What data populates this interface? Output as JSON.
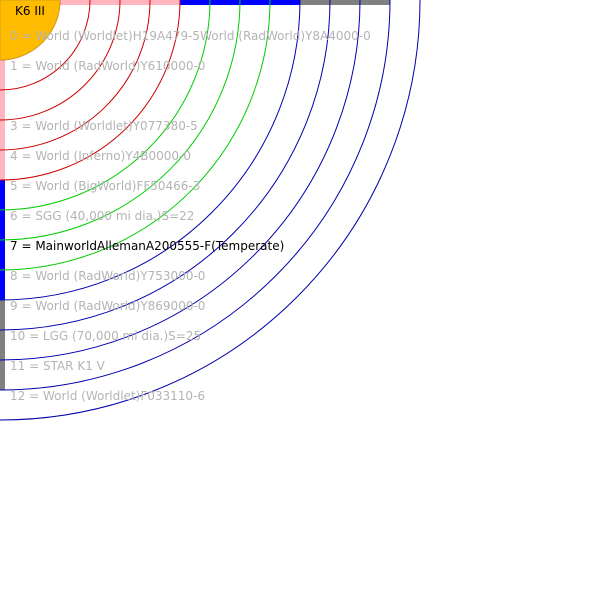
{
  "star": {
    "label": "K6 III",
    "fill_color": "#ffbb00",
    "edge_color": "#d4a017"
  },
  "zone_colors": {
    "hot": "#cc0000",
    "habitable": "#00cc00",
    "cold": "#0000aa",
    "pink": "#ffb6c1",
    "blue": "#0000ff",
    "gray": "#808080"
  },
  "orbit_zones": [
    "hot",
    "hot",
    "hot",
    "hot",
    "hot",
    "habitable",
    "habitable",
    "habitable",
    "cold",
    "cold",
    "cold",
    "cold",
    "cold"
  ],
  "orbits": [
    {
      "label": "0 = World  (Worldlet)H19A479-5World  (RadWorld)Y8A4000-0",
      "highlight": false
    },
    {
      "label": "1 = World  (RadWorld)Y610000-0",
      "highlight": false
    },
    {
      "label": "",
      "highlight": false
    },
    {
      "label": "3 = World  (Worldlet)Y077380-5",
      "highlight": false
    },
    {
      "label": "4 = World  (Inferno)Y4B0000-0",
      "highlight": false
    },
    {
      "label": "5 = World  (BigWorld)FF50466-3",
      "highlight": false
    },
    {
      "label": "6 = SGG (40,000 mi dia.)S=22",
      "highlight": false
    },
    {
      "label": "7 = MainworldAllemanA200555-F(Temperate)",
      "highlight": true
    },
    {
      "label": "8 = World  (RadWorld)Y753000-0",
      "highlight": false
    },
    {
      "label": "9 = World  (RadWorld)Y869000-0",
      "highlight": false
    },
    {
      "label": "10 = LGG (70,000 mi dia.)S=25",
      "highlight": false
    },
    {
      "label": "11 = STAR K1 V",
      "highlight": false
    },
    {
      "label": "12 = World  (Worldlet)F033110-6",
      "highlight": false
    }
  ],
  "text_colors": {
    "normal": "#b4b4b4",
    "highlight": "#000000"
  }
}
